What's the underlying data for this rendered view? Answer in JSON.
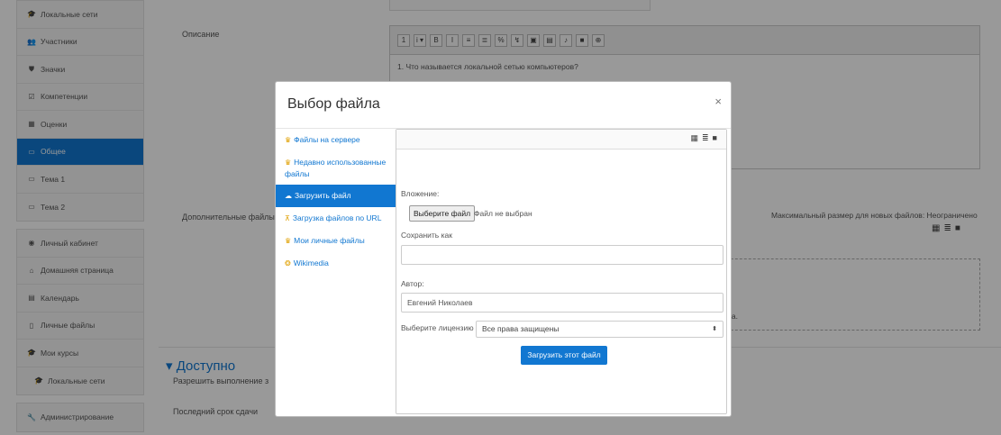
{
  "sidebar": {
    "group1": [
      {
        "label": "Локальные сети",
        "icon": "graduation-cap-icon",
        "glyph": "🎓"
      },
      {
        "label": "Участники",
        "icon": "users-icon",
        "glyph": "👥"
      },
      {
        "label": "Значки",
        "icon": "badge-icon",
        "glyph": "⛊"
      },
      {
        "label": "Компетенции",
        "icon": "checkbox-icon",
        "glyph": "☑"
      },
      {
        "label": "Оценки",
        "icon": "table-icon",
        "glyph": "▦"
      },
      {
        "label": "Общее",
        "icon": "folder-icon",
        "glyph": "▭",
        "active": true
      },
      {
        "label": "Тема 1",
        "icon": "folder-icon",
        "glyph": "▭"
      },
      {
        "label": "Тема 2",
        "icon": "folder-icon",
        "glyph": "▭"
      }
    ],
    "group2": [
      {
        "label": "Личный кабинет",
        "icon": "dashboard-icon",
        "glyph": "◉"
      },
      {
        "label": "Домашняя страница",
        "icon": "home-icon",
        "glyph": "⌂"
      },
      {
        "label": "Календарь",
        "icon": "calendar-icon",
        "glyph": "▤"
      },
      {
        "label": "Личные файлы",
        "icon": "file-icon",
        "glyph": "▯"
      },
      {
        "label": "Мои курсы",
        "icon": "graduation-cap-icon",
        "glyph": "🎓"
      },
      {
        "label": "Локальные сети",
        "icon": "graduation-cap-icon",
        "glyph": "🎓",
        "sub": true
      }
    ],
    "group3": [
      {
        "label": "Администрирование",
        "icon": "wrench-icon",
        "glyph": "🔧"
      }
    ]
  },
  "main": {
    "description_label": "Описание",
    "editor_text": "1. Что называется локальной сетью компьютеров?",
    "attachments_label": "Дополнительные файлы",
    "max_size": "Максимальный размер для новых файлов: Неограничено",
    "dropzone_text": "к сюда.",
    "section_title": "▾ Доступно",
    "allow_label": "Разрешить выполнение з",
    "deadline_label": "Последний срок сдачи"
  },
  "modal": {
    "title": "Выбор файла",
    "close": "×",
    "repos": [
      {
        "label": "Файлы на сервере",
        "icon": "server-files-icon"
      },
      {
        "label": "Недавно использованные файлы",
        "icon": "recent-files-icon"
      },
      {
        "label": "Загрузить файл",
        "icon": "upload-icon",
        "active": true
      },
      {
        "label": "Загрузка файлов по URL",
        "icon": "url-download-icon"
      },
      {
        "label": "Мои личные файлы",
        "icon": "private-files-icon"
      },
      {
        "label": "Wikimedia",
        "icon": "wikimedia-icon"
      }
    ],
    "attachment_label": "Вложение:",
    "choose_file": "Выберите файл",
    "no_file": "Файл не выбран",
    "save_as_label": "Сохранить как",
    "save_as_value": "",
    "author_label": "Автор:",
    "author_value": "Евгений Николаев",
    "license_label": "Выберите лицензию",
    "license_value": "Все права защищены",
    "upload_button": "Загрузить этот файл"
  }
}
